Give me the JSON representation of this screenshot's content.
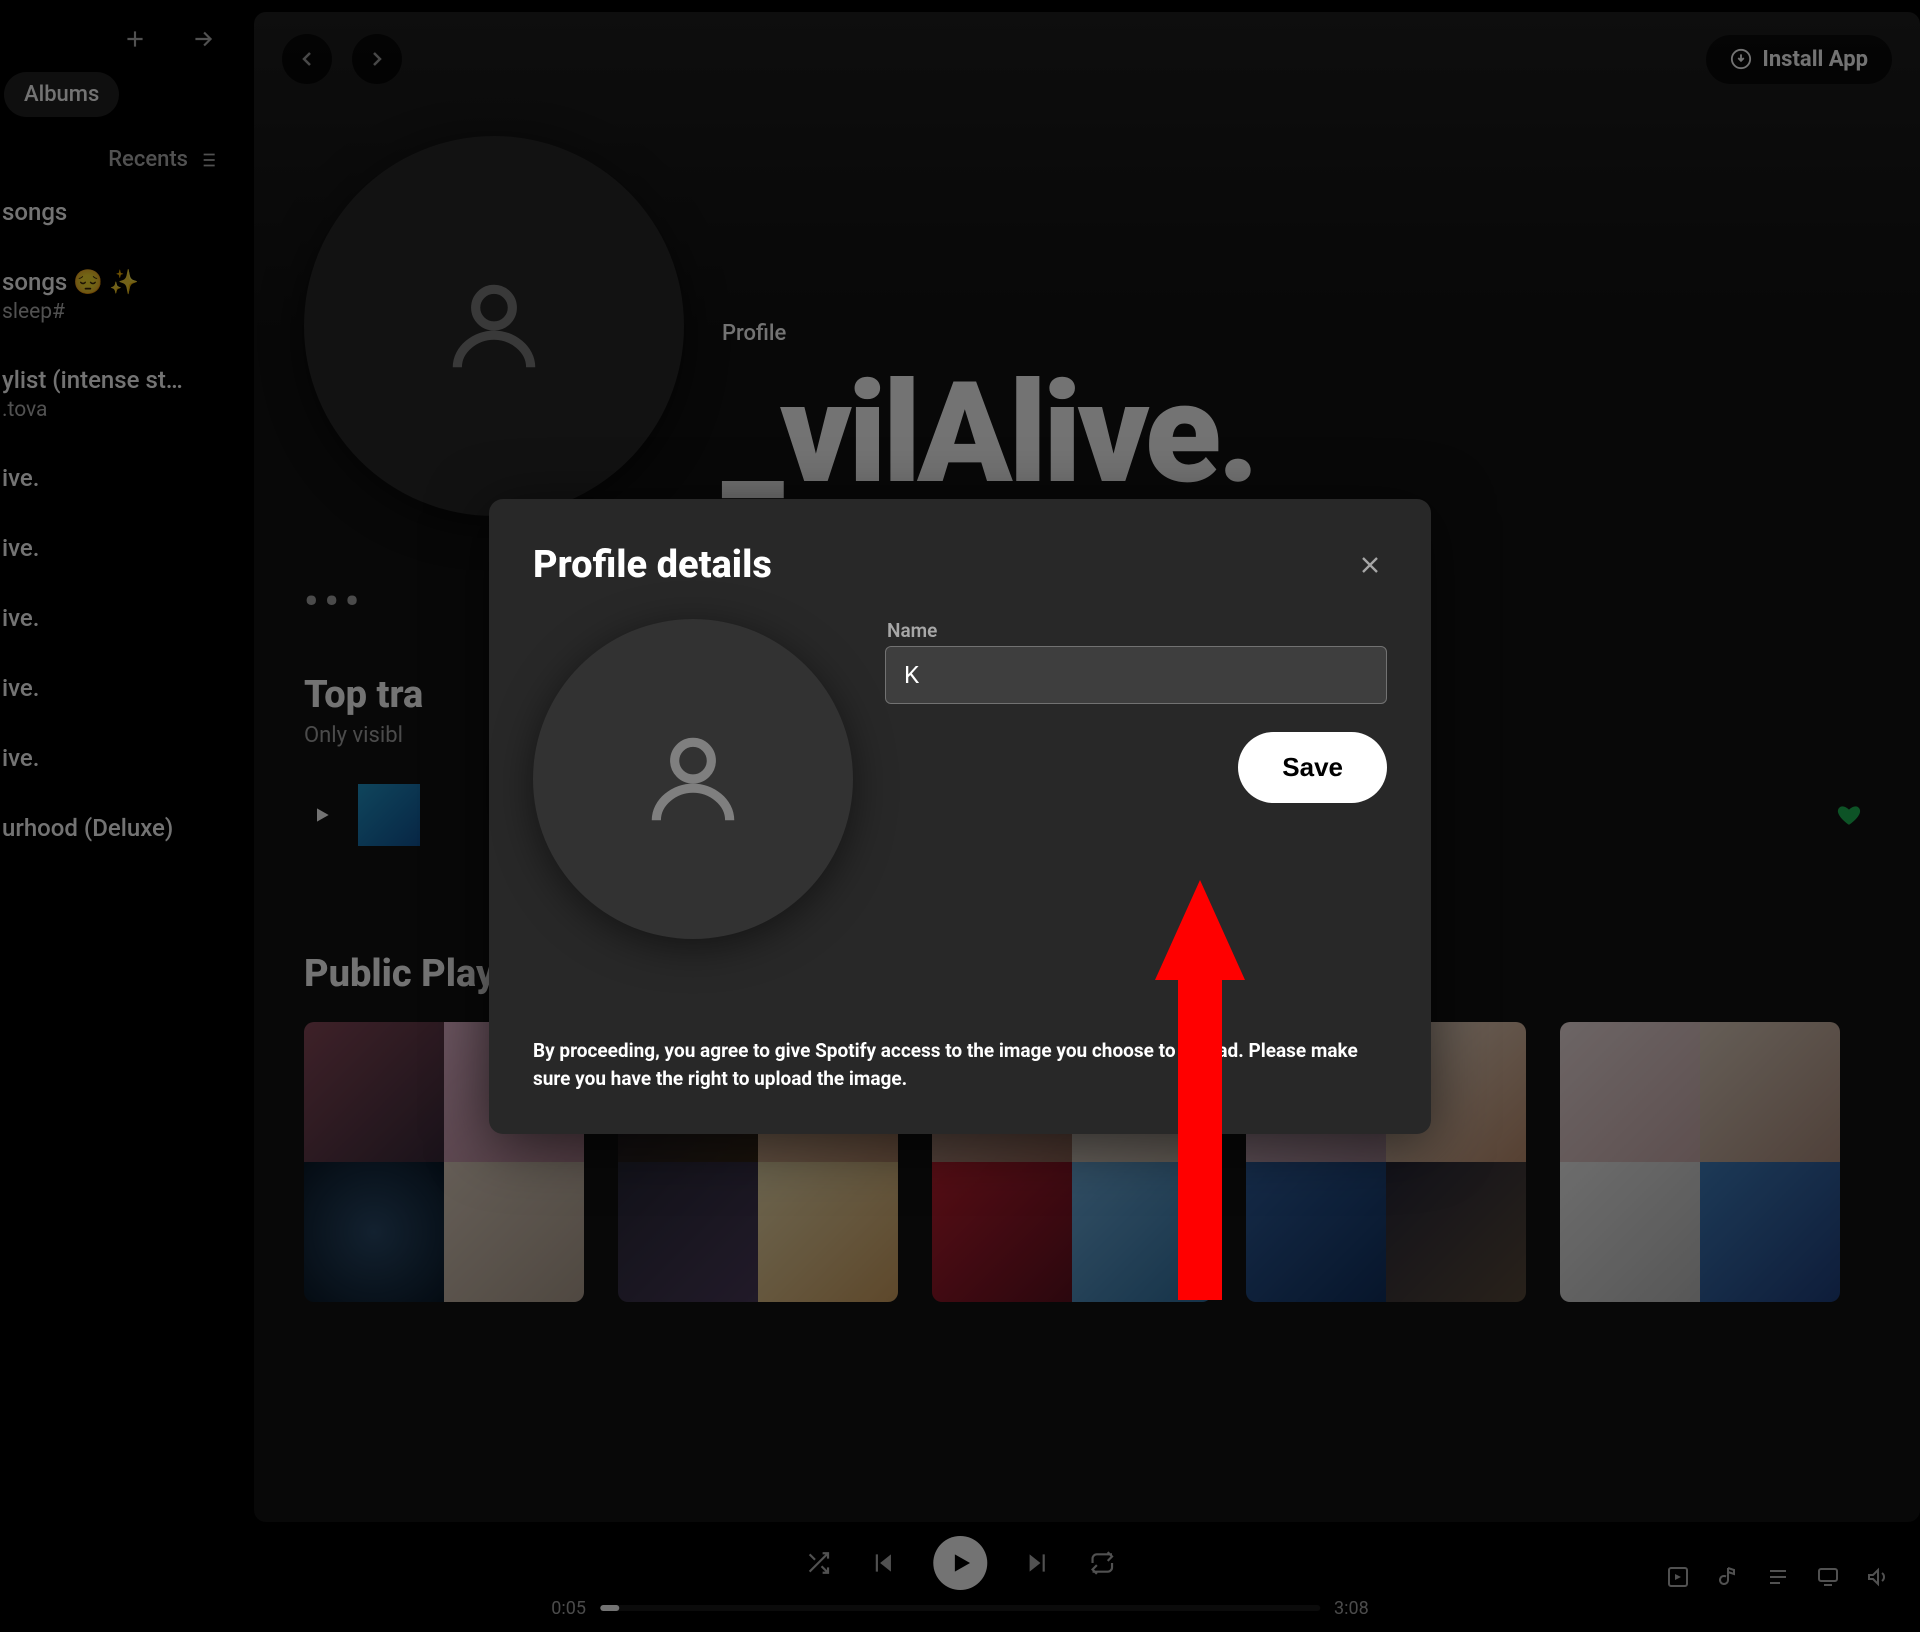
{
  "sidebar": {
    "chip": "Albums",
    "recents_label": "Recents",
    "items": [
      {
        "title": "songs",
        "subtitle": ""
      },
      {
        "title": "songs 😔 ✨",
        "subtitle": "sleep#"
      },
      {
        "title": "ylist (intense st…",
        "subtitle": ".tova"
      },
      {
        "title": "ive.",
        "subtitle": ""
      },
      {
        "title": "ive.",
        "subtitle": ""
      },
      {
        "title": "ive.",
        "subtitle": ""
      },
      {
        "title": "ive.",
        "subtitle": ""
      },
      {
        "title": "ive.",
        "subtitle": ""
      },
      {
        "title": "urhood (Deluxe)",
        "subtitle": ""
      }
    ]
  },
  "topbar": {
    "install_label": "Install App"
  },
  "profile": {
    "label": "Profile",
    "name": "_vilAlive."
  },
  "sections": {
    "top_tracks_title": "Top tra",
    "top_tracks_sub": "Only visibl",
    "public_playlists": "Public Playlists"
  },
  "modal": {
    "title": "Profile details",
    "name_label": "Name",
    "name_value": "K",
    "save_label": "Save",
    "legal": "By proceeding, you agree to give Spotify access to the image you choose to upload. Please make sure you have the right to upload the image."
  },
  "player": {
    "elapsed": "0:05",
    "duration": "3:08"
  }
}
